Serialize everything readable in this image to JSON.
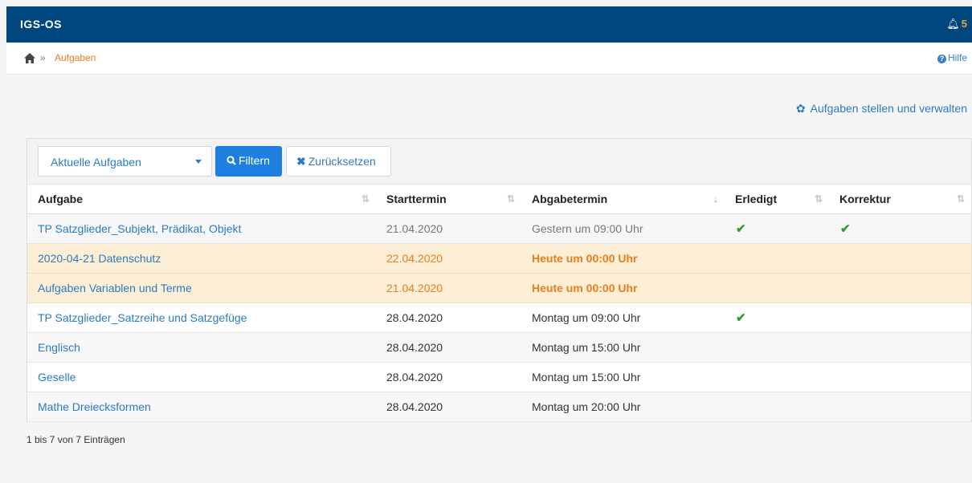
{
  "app": {
    "brand": "IGS-OS",
    "notifications": "5"
  },
  "breadcrumb": {
    "separator": "»",
    "current": "Aufgaben",
    "help": "Hilfe"
  },
  "manage_link": "Aufgaben stellen und verwalten",
  "toolbar": {
    "select_value": "Aktuelle Aufgaben",
    "filter_label": "Filtern",
    "reset_label": "Zurücksetzen"
  },
  "table": {
    "headers": [
      "Aufgabe",
      "Starttermin",
      "Abgabetermin",
      "Erledigt",
      "Korrektur"
    ],
    "rows": [
      {
        "task": "TP Satzglieder_Subjekt, Prädikat, Objekt",
        "start": "21.04.2020",
        "due": "Gestern um 09:00 Uhr",
        "done": "✔",
        "corrected": "✔"
      },
      {
        "task": "2020-04-21 Datenschutz",
        "start": "22.04.2020",
        "due": "Heute um 00:00 Uhr",
        "done": "",
        "corrected": ""
      },
      {
        "task": "Aufgaben Variablen und Terme",
        "start": "21.04.2020",
        "due": "Heute um 00:00 Uhr",
        "done": "",
        "corrected": ""
      },
      {
        "task": "TP Satzglieder_Satzreihe und Satzgefüge",
        "start": "28.04.2020",
        "due": "Montag um 09:00 Uhr",
        "done": "✔",
        "corrected": ""
      },
      {
        "task": "Englisch",
        "start": "28.04.2020",
        "due": "Montag um 15:00 Uhr",
        "done": "",
        "corrected": ""
      },
      {
        "task": "Geselle",
        "start": "28.04.2020",
        "due": "Montag um 15:00 Uhr",
        "done": "",
        "corrected": ""
      },
      {
        "task": "Mathe Dreiecksformen",
        "start": "28.04.2020",
        "due": "Montag um 20:00 Uhr",
        "done": "",
        "corrected": ""
      }
    ]
  },
  "footer": {
    "info": "1 bis 7 von 7 Einträgen"
  },
  "colors": {
    "topbar": "#00467f",
    "link": "#2b7bc4",
    "accent": "#e87d1e",
    "warn_row": "#fcefd6",
    "check": "#2ca02c",
    "primary_button": "#1f7fe0"
  },
  "icons": {
    "home": "home-icon",
    "bell": "bell-icon",
    "help": "help-icon",
    "gear": "gear-icon",
    "search": "search-icon",
    "reset": "close-icon",
    "sort": "sort-icon",
    "check": "check-icon"
  }
}
